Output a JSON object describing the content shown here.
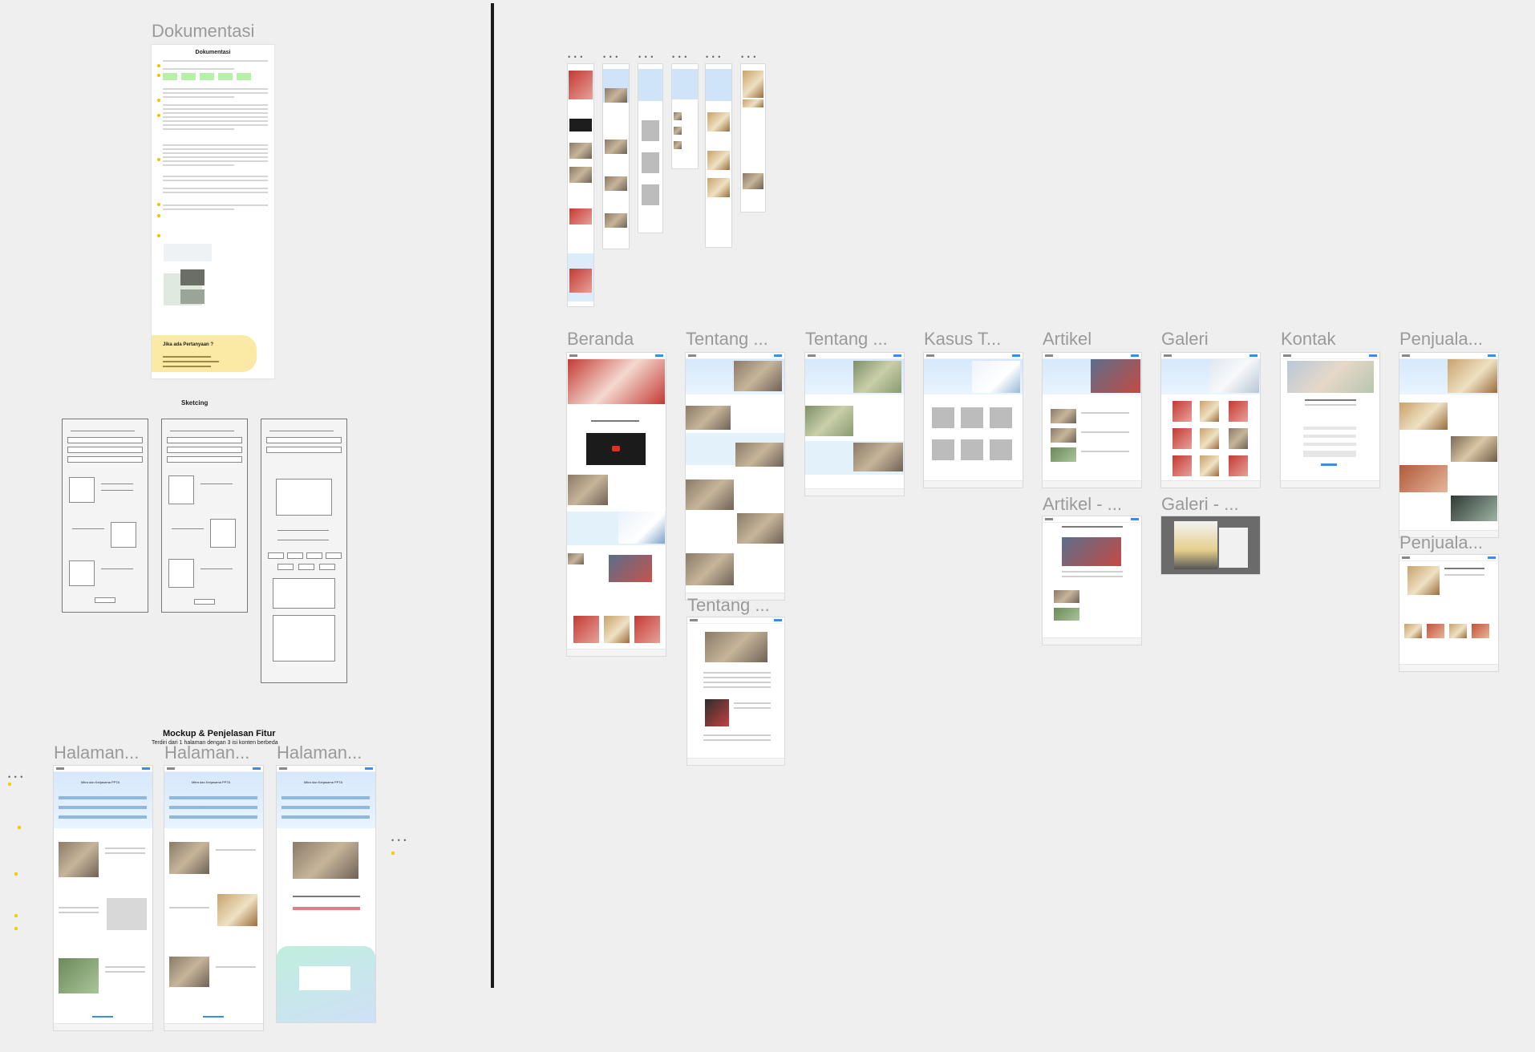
{
  "documentation": {
    "section_title": "Dokumentasi",
    "card_title": "Dokumentasi",
    "faq_title": "Jika ada Pertanyaan ?"
  },
  "sketching": {
    "title": "Sketcing"
  },
  "mockup": {
    "title": "Mockup & Penjelasan Fitur",
    "subtitle": "Terdiri dari 1 halaman dengan 3 isi konten berbeda",
    "frames": [
      "Halaman...",
      "Halaman...",
      "Halaman..."
    ],
    "frame_heading": "Mitra dan Kerjasama PPTA"
  },
  "frames": {
    "beranda": "Beranda",
    "tentang1": "Tentang ...",
    "tentang2": "Tentang ...",
    "kasus": "Kasus T...",
    "artikel": "Artikel",
    "galeri": "Galeri",
    "kontak": "Kontak",
    "penjualan": "Penjuala...",
    "artikel_detail": "Artikel - ...",
    "galeri_detail": "Galeri - ...",
    "penjualan_detail": "Penjuala...",
    "tentang3": "Tentang ..."
  },
  "colors": {
    "accent": "#3c8cf0",
    "divider": "#1a1a1a",
    "frame_title": "#9a9a9a",
    "faq_bg": "#fbe9a6"
  }
}
